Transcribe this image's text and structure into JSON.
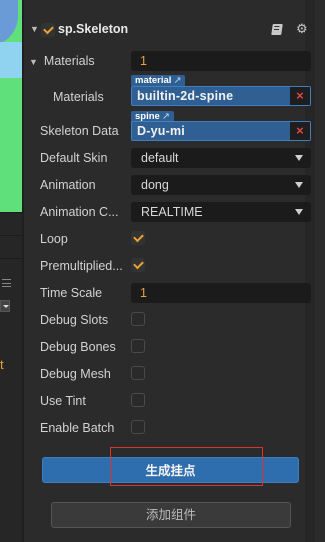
{
  "component": {
    "title": "sp.Skeleton",
    "enabled": true,
    "icons": {
      "docs": "book-icon",
      "settings": "gear-icon"
    }
  },
  "materials": {
    "label": "Materials",
    "count": "1",
    "item_label": "Materials",
    "tag": "material",
    "tag_icon": "↗",
    "value": "builtin-2d-spine",
    "clear": "×"
  },
  "skeleton_data": {
    "label": "Skeleton Data",
    "tag": "spine",
    "tag_icon": "↗",
    "value": "D-yu-mi",
    "clear": "×"
  },
  "default_skin": {
    "label": "Default Skin",
    "value": "default"
  },
  "animation": {
    "label": "Animation",
    "value": "dong"
  },
  "animation_cache": {
    "label": "Animation C...",
    "value": "REALTIME"
  },
  "loop": {
    "label": "Loop",
    "checked": true
  },
  "premultiplied": {
    "label": "Premultiplied...",
    "checked": true
  },
  "time_scale": {
    "label": "Time Scale",
    "value": "1"
  },
  "debug_slots": {
    "label": "Debug Slots",
    "checked": false
  },
  "debug_bones": {
    "label": "Debug Bones",
    "checked": false
  },
  "debug_mesh": {
    "label": "Debug Mesh",
    "checked": false
  },
  "use_tint": {
    "label": "Use Tint",
    "checked": false
  },
  "enable_batch": {
    "label": "Enable Batch",
    "checked": false
  },
  "buttons": {
    "generate_attach_points": "生成挂点",
    "add_component": "添加组件"
  },
  "left_strip": {
    "glyph": "t"
  },
  "colors": {
    "accent": "#f0a030",
    "asset_blue": "#2f5f93",
    "primary_button": "#2f6eae",
    "highlight": "#e0322c",
    "clear_red": "#e04848"
  }
}
